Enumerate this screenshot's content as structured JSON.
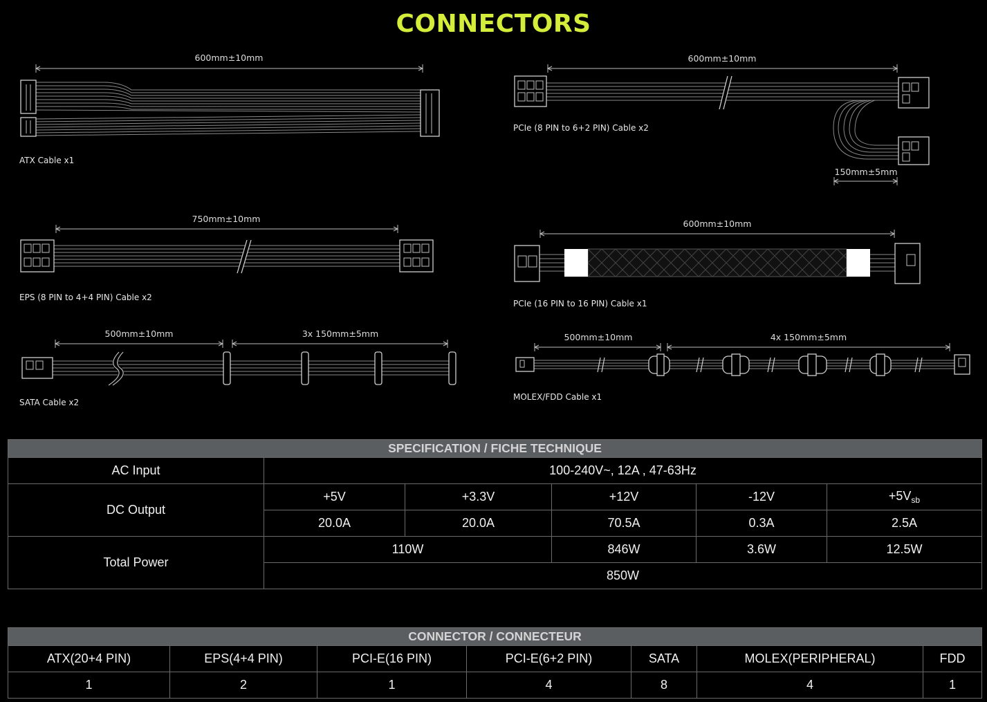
{
  "title": "CONNECTORS",
  "colors": {
    "title": "#d4ec3a",
    "header_bg": "#5b5e61",
    "background": "#000000"
  },
  "cables": {
    "atx": {
      "caption": "ATX Cable x1",
      "length": "600mm±10mm"
    },
    "pcie_8_to_62": {
      "caption": "PCIe (8 PIN to 6+2 PIN) Cable x2",
      "length": "600mm±10mm",
      "branch": "150mm±5mm"
    },
    "eps": {
      "caption": "EPS (8 PIN to 4+4 PIN) Cable x2",
      "length": "750mm±10mm"
    },
    "pcie_16": {
      "caption": "PCIe (16 PIN to 16 PIN) Cable x1",
      "length": "600mm±10mm"
    },
    "sata": {
      "caption": "SATA Cable x2",
      "length": "500mm±10mm",
      "branch": "3x 150mm±5mm"
    },
    "molex": {
      "caption": "MOLEX/FDD Cable x1",
      "length": "500mm±10mm",
      "branch": "4x 150mm±5mm"
    }
  },
  "spec": {
    "header": "SPECIFICATION / FICHE TECHNIQUE",
    "ac_input_label": "AC Input",
    "ac_input_value": "100-240V~, 12A , 47-63Hz",
    "dc_output_label": "DC Output",
    "rails": [
      "+5V",
      "+3.3V",
      "+12V",
      "-12V"
    ],
    "rail_sb_main": "+5V",
    "rail_sb_sub": "sb",
    "currents": [
      "20.0A",
      "20.0A",
      "70.5A",
      "0.3A",
      "2.5A"
    ],
    "total_power_label": "Total Power",
    "combined_5v_33v": "110W",
    "power_12v": "846W",
    "power_m12v": "3.6W",
    "power_sb": "12.5W",
    "total": "850W"
  },
  "connectors": {
    "header": "CONNECTOR / CONNECTEUR",
    "columns": [
      "ATX(20+4 PIN)",
      "EPS(4+4 PIN)",
      "PCI-E(16 PIN)",
      "PCI-E(6+2 PIN)",
      "SATA",
      "MOLEX(PERIPHERAL)",
      "FDD"
    ],
    "counts": [
      "1",
      "2",
      "1",
      "4",
      "8",
      "4",
      "1"
    ]
  }
}
